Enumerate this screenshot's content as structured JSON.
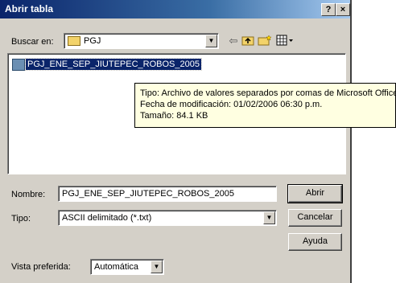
{
  "window": {
    "title": "Abrir tabla",
    "help_label": "?",
    "close_label": "×"
  },
  "toolbar": {
    "look_in_label": "Buscar en:",
    "look_in_value": "PGJ",
    "back_icon": "back-arrow-icon",
    "up_icon": "up-folder-icon",
    "new_folder_icon": "new-folder-icon",
    "views_icon": "views-menu-icon"
  },
  "file_list": {
    "items": [
      {
        "name": "PGJ_ENE_SEP_JIUTEPEC_ROBOS_2005"
      }
    ]
  },
  "tooltip": {
    "type_line": "Tipo: Archivo de valores separados por comas de Microsoft Office Excel",
    "modified_line": "Fecha de modificación: 01/02/2006 06:30 p.m.",
    "size_line": "Tamaño: 84.1 KB"
  },
  "form": {
    "name_label": "Nombre:",
    "name_value": "PGJ_ENE_SEP_JIUTEPEC_ROBOS_2005",
    "type_label": "Tipo:",
    "type_value": "ASCII delimitado (*.txt)",
    "view_label": "Vista preferida:",
    "view_value": "Automática"
  },
  "buttons": {
    "open": "Abrir",
    "cancel": "Cancelar",
    "help": "Ayuda"
  },
  "colors": {
    "selection": "#0a246a",
    "tooltip_bg": "#ffffe1",
    "dialog_bg": "#d4d0c8"
  }
}
